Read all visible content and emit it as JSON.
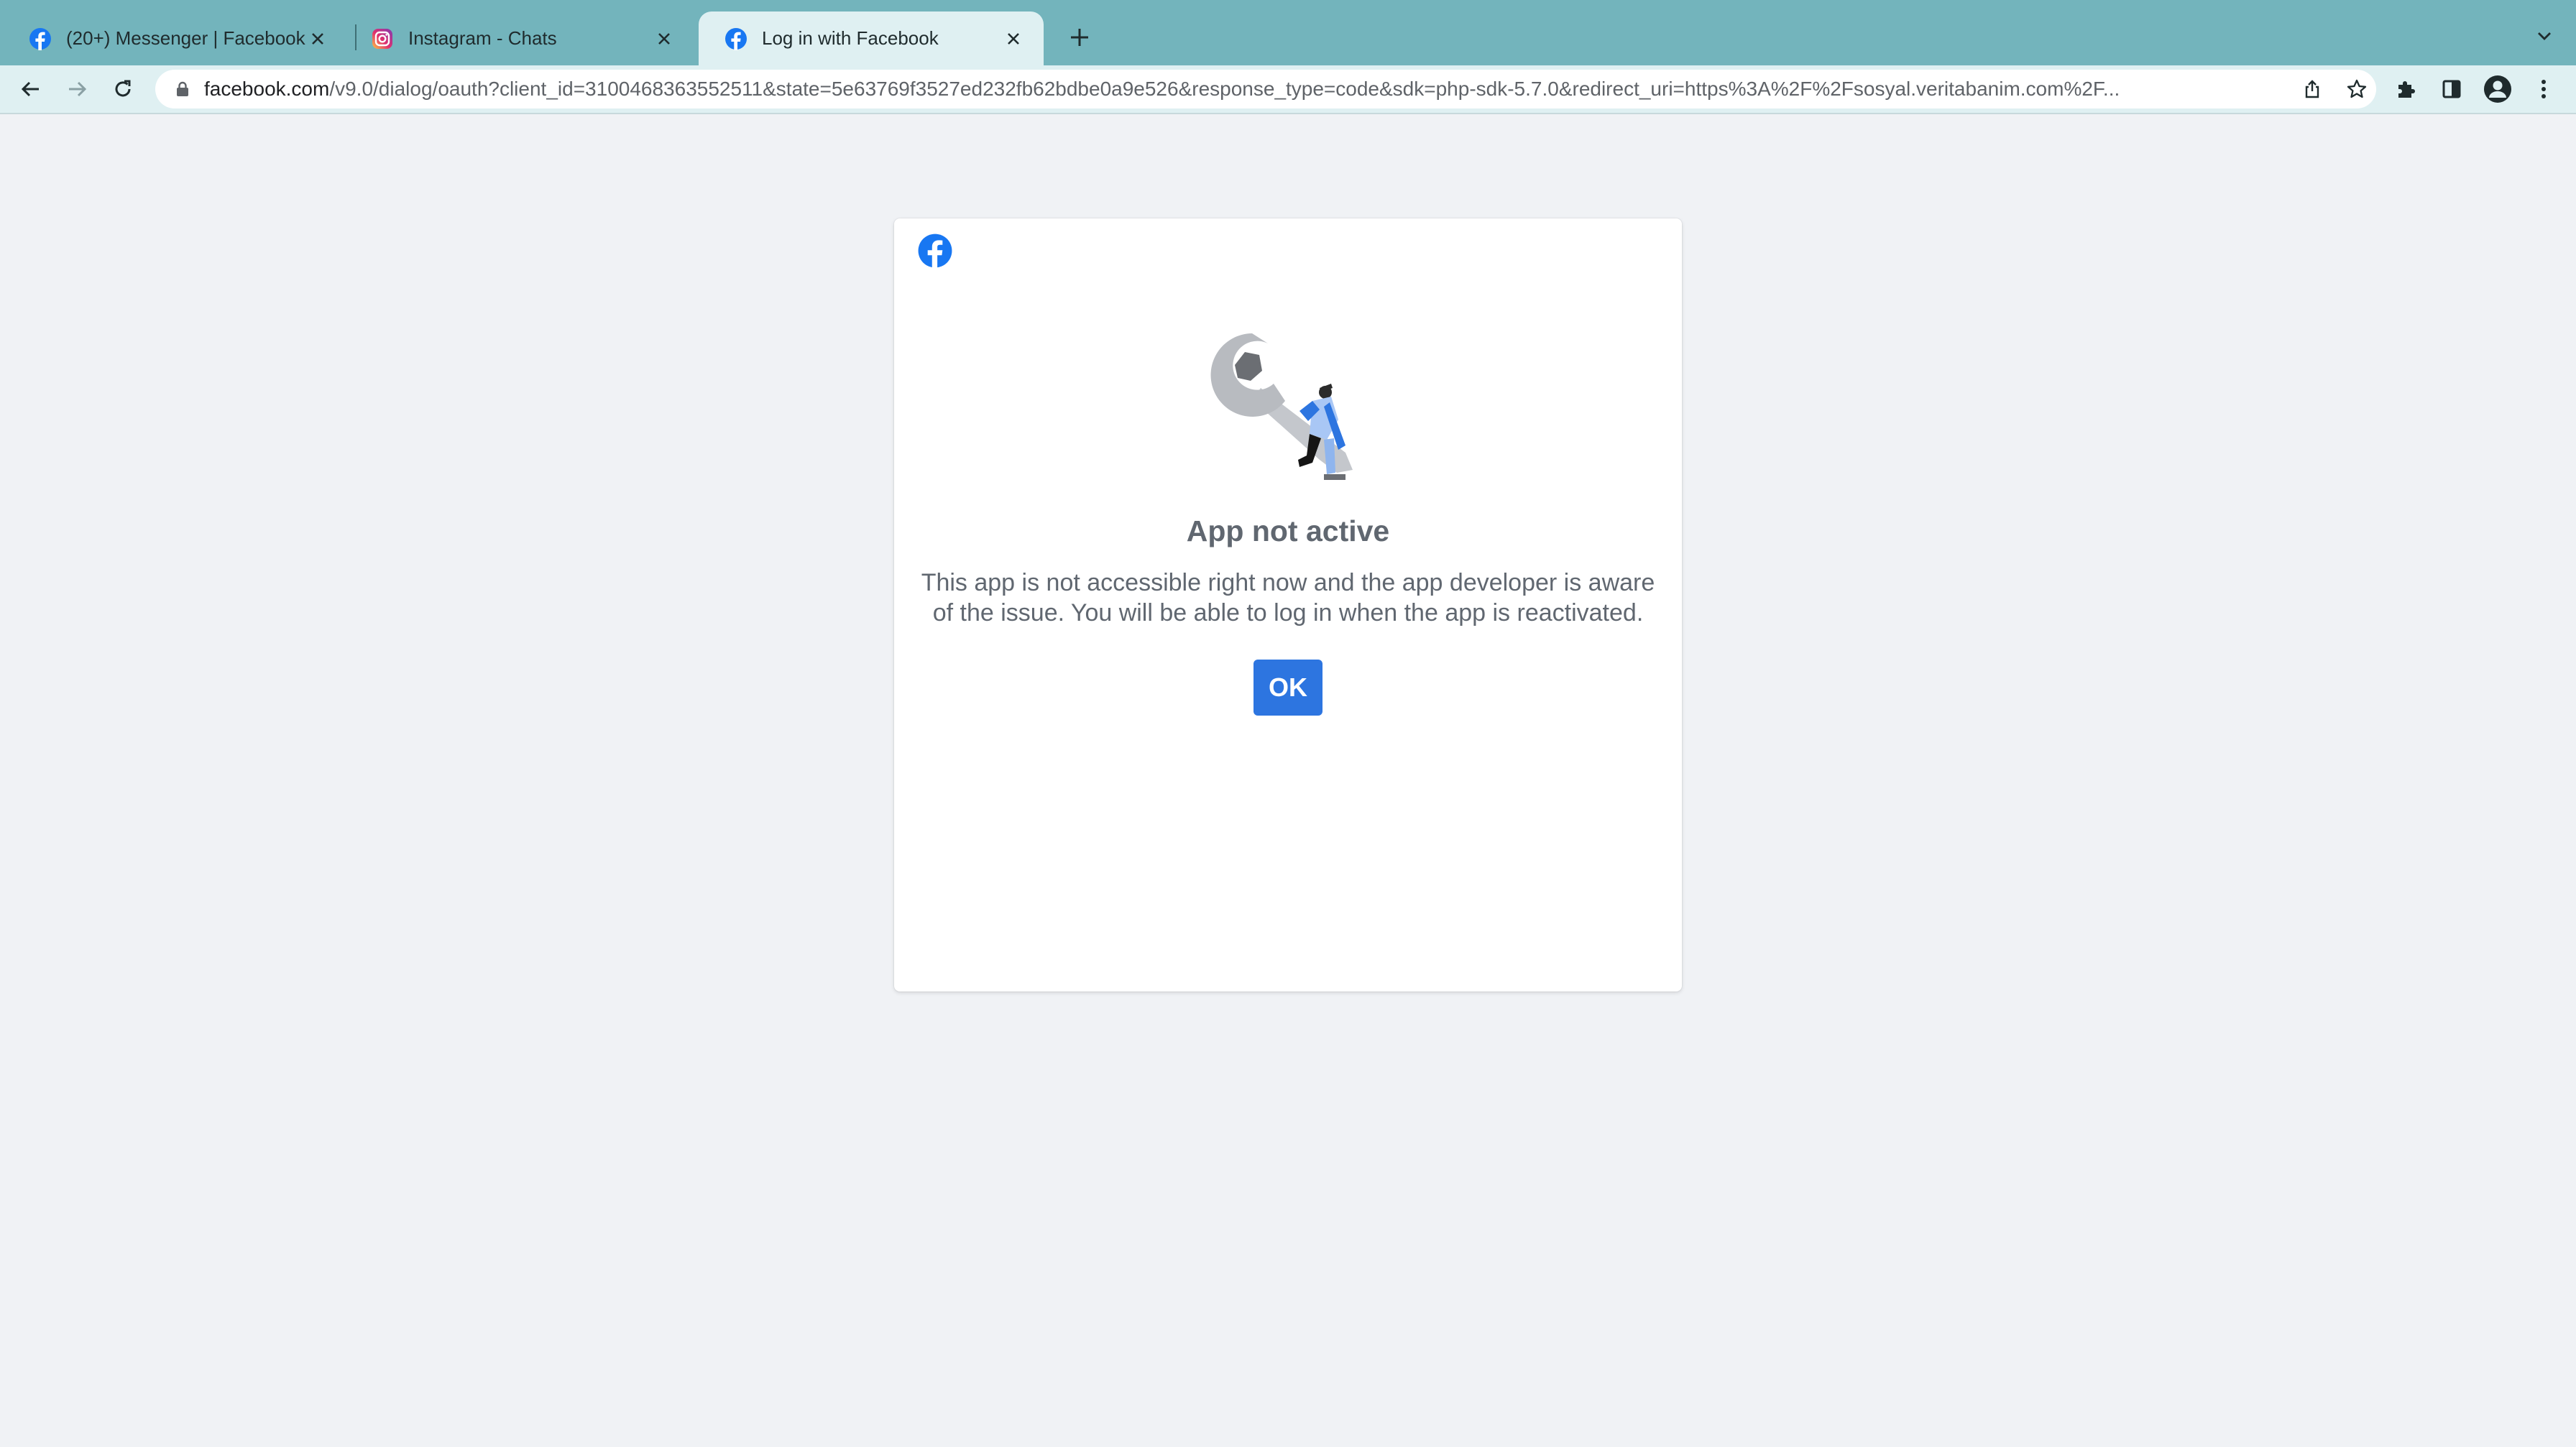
{
  "browser": {
    "tabs": [
      {
        "title": "(20+) Messenger | Facebook",
        "icon": "facebook-icon"
      },
      {
        "title": "Instagram - Chats",
        "icon": "instagram-icon"
      },
      {
        "title": "Log in with Facebook",
        "icon": "facebook-icon",
        "active": true
      }
    ],
    "url_domain": "facebook.com",
    "url_path": "/v9.0/dialog/oauth?client_id=3100468363552511&state=5e63769f3527ed232fb62bdbe0a9e526&response_type=code&sdk=php-sdk-5.7.0&redirect_uri=https%3A%2F%2Fsosyal.veritabanim.com%2F..."
  },
  "dialog": {
    "heading": "App not active",
    "message": "This app is not accessible right now and the app developer is aware of the issue. You will be able to log in when the app is reactivated.",
    "ok_label": "OK"
  },
  "colors": {
    "tabbar": "#73b4bc",
    "toolbar": "#dff0f2",
    "page_bg": "#f0f2f5",
    "facebook_blue": "#1877f2",
    "button_blue": "#2d75e0",
    "text_gray": "#606770"
  }
}
